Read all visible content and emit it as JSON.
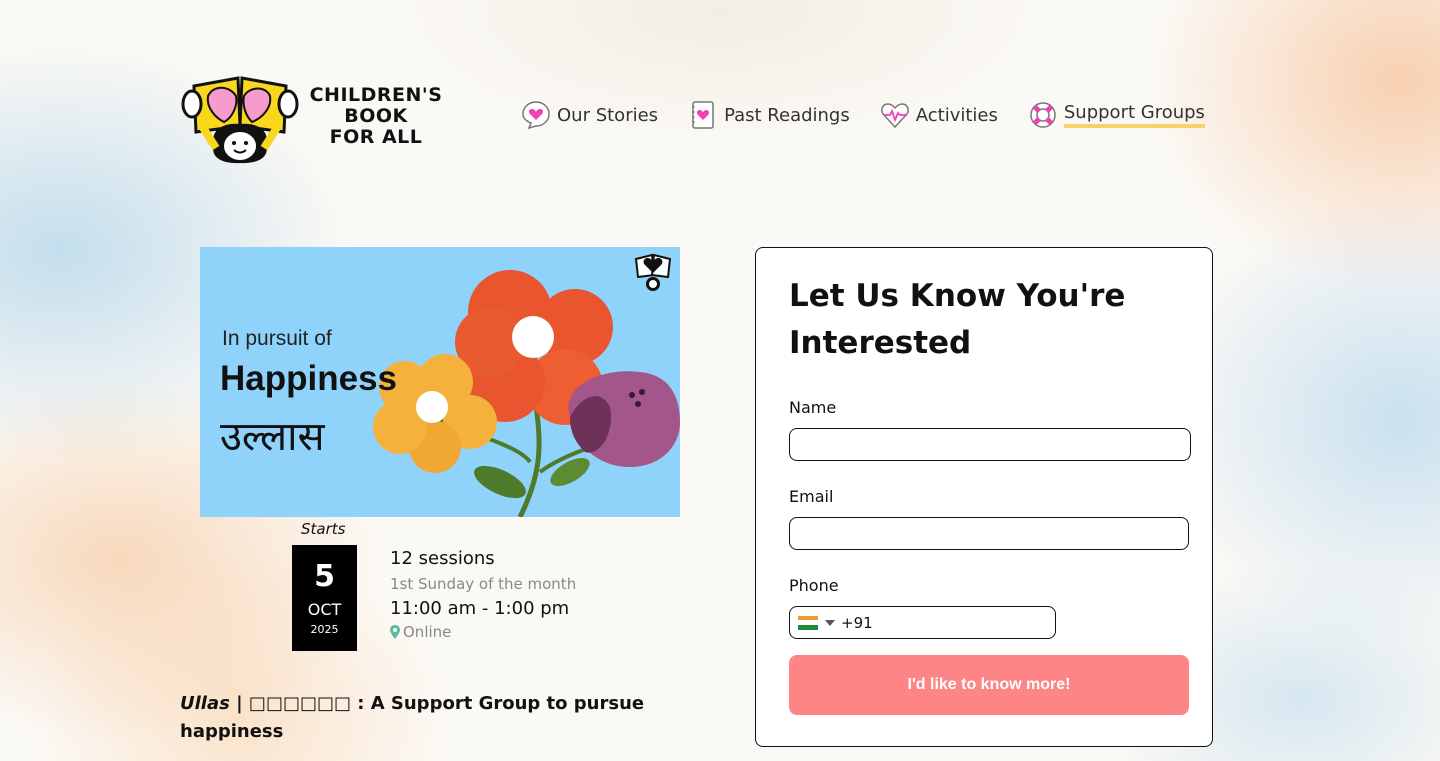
{
  "logo": {
    "lines": [
      "CHILDREN'S",
      "BOOK",
      "FOR ALL"
    ]
  },
  "nav": {
    "items": [
      {
        "label": "Our Stories",
        "icon": "speech-heart-icon"
      },
      {
        "label": "Past Readings",
        "icon": "notebook-heart-icon"
      },
      {
        "label": "Activities",
        "icon": "heartbeat-icon"
      },
      {
        "label": "Support Groups",
        "icon": "lifebuoy-icon",
        "active": true
      }
    ],
    "active_underline_color": "#f7d16b"
  },
  "event": {
    "image": {
      "line1": "In pursuit of",
      "line2": "Happiness",
      "line3": "उल्लास",
      "background": "#8fd3fb"
    },
    "starts_label": "Starts",
    "date": {
      "day": "5",
      "month": "OCT",
      "year": "2025"
    },
    "sessions": "12 sessions",
    "frequency": "1st Sunday of the month",
    "time": "11:00 am - 1:00 pm",
    "location": "Online",
    "title_name": "Ullas",
    "title_rest": " | □□□□□□ : A Support Group to pursue happiness"
  },
  "form": {
    "heading": "Let Us Know You're Interested",
    "name_label": "Name",
    "name_value": "",
    "email_label": "Email",
    "email_value": "",
    "phone_label": "Phone",
    "phone_prefix": "+91",
    "submit_label": "I'd like to know more!",
    "submit_color": "#fd8585"
  }
}
